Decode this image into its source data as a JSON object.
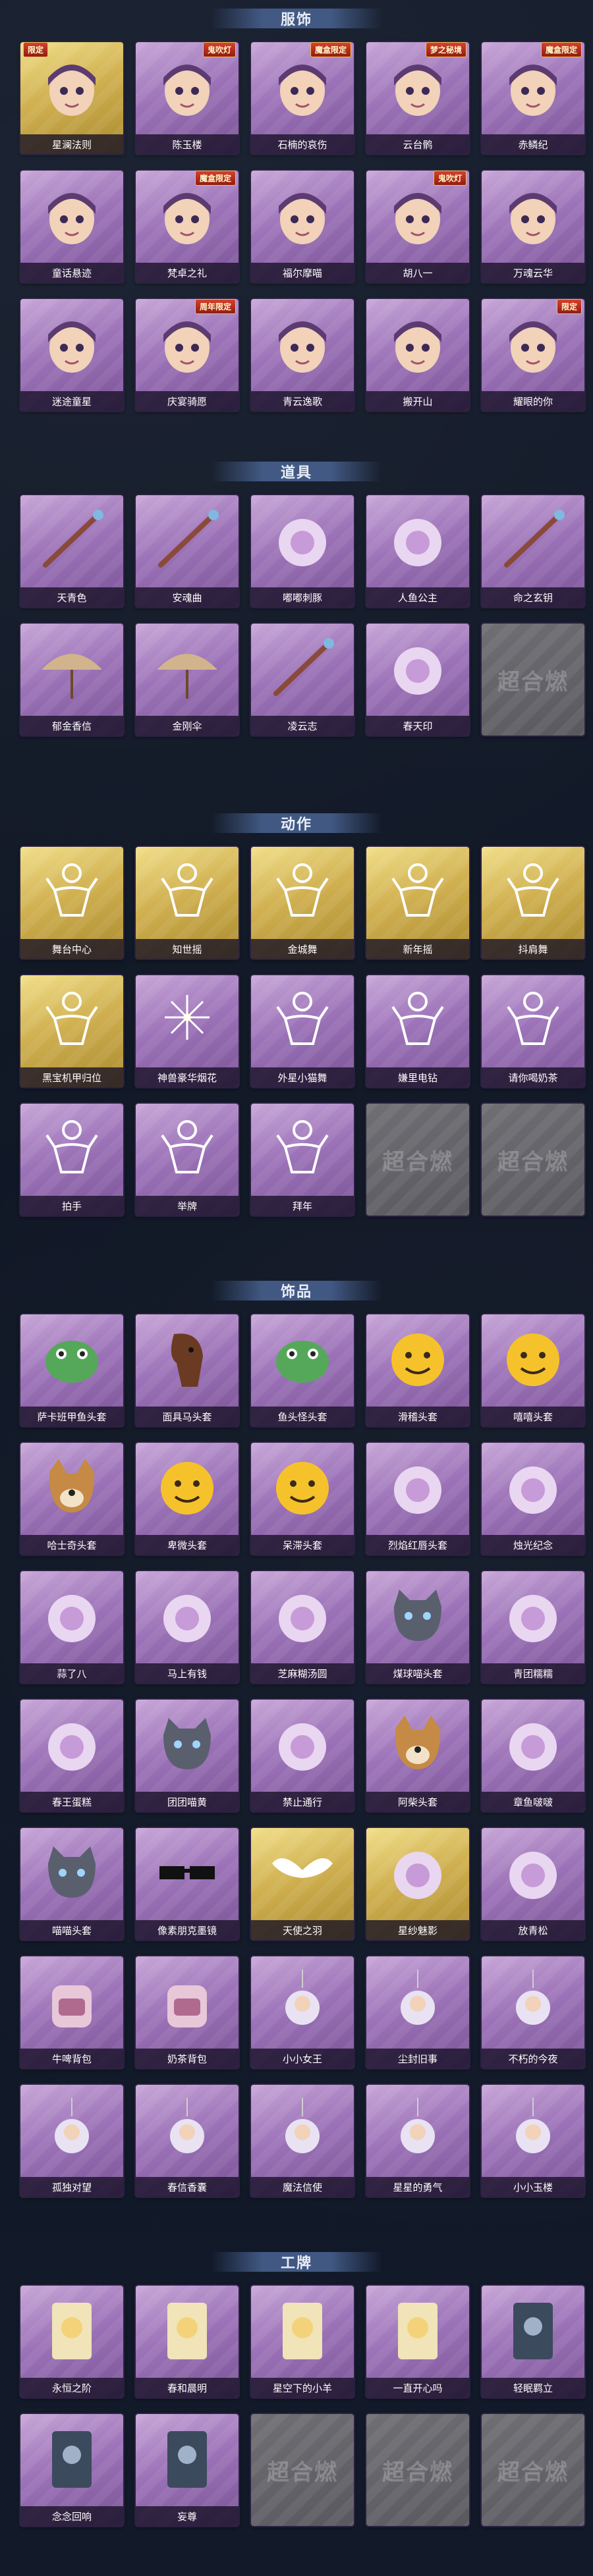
{
  "sections": [
    {
      "title": "服饰",
      "items": [
        {
          "label": "星澜法则",
          "badge": "限定",
          "icon": "character-portrait-icon",
          "tier": "gold"
        },
        {
          "label": "陈玉楼",
          "badge": "鬼吹灯",
          "icon": "character-portrait-icon",
          "tier": "purple"
        },
        {
          "label": "石楠的哀伤",
          "badge": "魔盒限定",
          "icon": "character-portrait-icon",
          "tier": "purple"
        },
        {
          "label": "云台鹘",
          "badge": "梦之秘境",
          "icon": "character-portrait-icon",
          "tier": "purple"
        },
        {
          "label": "赤鳞纪",
          "badge": "魔盒限定",
          "icon": "character-portrait-icon",
          "tier": "purple"
        },
        {
          "label": "童话悬迹",
          "badge": "",
          "icon": "character-portrait-icon",
          "tier": "purple"
        },
        {
          "label": "梵卓之礼",
          "badge": "魔盒限定",
          "icon": "character-portrait-icon",
          "tier": "purple"
        },
        {
          "label": "福尔摩喵",
          "badge": "",
          "icon": "character-portrait-icon",
          "tier": "purple"
        },
        {
          "label": "胡八一",
          "badge": "鬼吹灯",
          "icon": "character-portrait-icon",
          "tier": "purple"
        },
        {
          "label": "万魂云华",
          "badge": "",
          "icon": "character-portrait-icon",
          "tier": "purple"
        },
        {
          "label": "迷途童星",
          "badge": "",
          "icon": "character-portrait-icon",
          "tier": "purple"
        },
        {
          "label": "庆宴骑愿",
          "badge": "周年限定",
          "icon": "character-portrait-icon",
          "tier": "purple"
        },
        {
          "label": "青云逸歌",
          "badge": "",
          "icon": "character-portrait-icon",
          "tier": "purple"
        },
        {
          "label": "搬开山",
          "badge": "",
          "icon": "character-portrait-icon",
          "tier": "purple"
        },
        {
          "label": "耀眼的你",
          "badge": "限定",
          "icon": "character-portrait-icon",
          "tier": "purple"
        }
      ]
    },
    {
      "title": "道具",
      "items": [
        {
          "label": "天青色",
          "badge": "",
          "icon": "wand-icon",
          "tier": "purple"
        },
        {
          "label": "安魂曲",
          "badge": "",
          "icon": "sword-icon",
          "tier": "purple"
        },
        {
          "label": "嘟嘟刺豚",
          "badge": "",
          "icon": "pufferfish-icon",
          "tier": "purple"
        },
        {
          "label": "人鱼公主",
          "badge": "",
          "icon": "mermaid-icon",
          "tier": "purple"
        },
        {
          "label": "命之玄钥",
          "badge": "",
          "icon": "key-icon",
          "tier": "purple"
        },
        {
          "label": "郁金香信",
          "badge": "",
          "icon": "umbrella-icon",
          "tier": "purple"
        },
        {
          "label": "金刚伞",
          "badge": "",
          "icon": "umbrella-icon",
          "tier": "purple"
        },
        {
          "label": "凌云志",
          "badge": "",
          "icon": "spear-icon",
          "tier": "purple"
        },
        {
          "label": "春天印",
          "badge": "",
          "icon": "gift-box-icon",
          "tier": "purple"
        },
        {
          "label": "",
          "badge": "",
          "icon": "",
          "tier": "empty",
          "placeholder": "超合燃"
        }
      ]
    },
    {
      "title": "动作",
      "items": [
        {
          "label": "舞台中心",
          "badge": "",
          "icon": "dance-pose-icon",
          "tier": "gold"
        },
        {
          "label": "知世摇",
          "badge": "",
          "icon": "dance-pose-icon",
          "tier": "gold"
        },
        {
          "label": "金城舞",
          "badge": "",
          "icon": "dance-pose-icon",
          "tier": "gold"
        },
        {
          "label": "新年摇",
          "badge": "",
          "icon": "dance-pose-icon",
          "tier": "gold"
        },
        {
          "label": "抖肩舞",
          "badge": "",
          "icon": "dance-pose-icon",
          "tier": "gold"
        },
        {
          "label": "黑宝机甲归位",
          "badge": "",
          "icon": "dance-pose-icon",
          "tier": "gold"
        },
        {
          "label": "神兽豪华烟花",
          "badge": "",
          "icon": "fireworks-icon",
          "tier": "purple"
        },
        {
          "label": "外星小猫舞",
          "badge": "",
          "icon": "dance-pose-icon",
          "tier": "purple"
        },
        {
          "label": "嫌里电钻",
          "badge": "",
          "icon": "dance-pose-icon",
          "tier": "purple"
        },
        {
          "label": "请你喝奶茶",
          "badge": "",
          "icon": "dance-pose-icon",
          "tier": "purple"
        },
        {
          "label": "拍手",
          "badge": "",
          "icon": "dance-pose-icon",
          "tier": "purple"
        },
        {
          "label": "举牌",
          "badge": "",
          "icon": "dance-pose-icon",
          "tier": "purple"
        },
        {
          "label": "拜年",
          "badge": "",
          "icon": "dance-pose-icon",
          "tier": "purple"
        },
        {
          "label": "",
          "badge": "",
          "icon": "",
          "tier": "empty",
          "placeholder": "超合燃"
        },
        {
          "label": "",
          "badge": "",
          "icon": "",
          "tier": "empty",
          "placeholder": "超合燃"
        }
      ]
    },
    {
      "title": "饰品",
      "items": [
        {
          "label": "萨卡班甲鱼头套",
          "badge": "",
          "icon": "fish-head-icon",
          "tier": "purple"
        },
        {
          "label": "面具马头套",
          "badge": "",
          "icon": "horse-head-icon",
          "tier": "purple"
        },
        {
          "label": "鱼头怪头套",
          "badge": "",
          "icon": "fish-head-icon",
          "tier": "purple"
        },
        {
          "label": "滑稽头套",
          "badge": "",
          "icon": "emoji-face-icon",
          "tier": "purple"
        },
        {
          "label": "嘻嘻头套",
          "badge": "",
          "icon": "emoji-face-icon",
          "tier": "purple"
        },
        {
          "label": "哈士奇头套",
          "badge": "",
          "icon": "dog-head-icon",
          "tier": "purple"
        },
        {
          "label": "卑微头套",
          "badge": "",
          "icon": "emoji-face-icon",
          "tier": "purple"
        },
        {
          "label": "呆滞头套",
          "badge": "",
          "icon": "emoji-face-icon",
          "tier": "purple"
        },
        {
          "label": "烈焰红唇头套",
          "badge": "",
          "icon": "pikachu-head-icon",
          "tier": "purple"
        },
        {
          "label": "烛光纪念",
          "badge": "",
          "icon": "candle-icon",
          "tier": "purple"
        },
        {
          "label": "蒜了八",
          "badge": "",
          "icon": "garlic-icon",
          "tier": "purple"
        },
        {
          "label": "马上有钱",
          "badge": "",
          "icon": "horse-toy-icon",
          "tier": "purple"
        },
        {
          "label": "芝麻糊汤圆",
          "badge": "",
          "icon": "dumpling-icon",
          "tier": "purple"
        },
        {
          "label": "煤球喵头套",
          "badge": "",
          "icon": "cat-head-icon",
          "tier": "purple"
        },
        {
          "label": "青团糯糯",
          "badge": "",
          "icon": "dumpling-icon",
          "tier": "purple"
        },
        {
          "label": "春王蛋糕",
          "badge": "",
          "icon": "cake-icon",
          "tier": "purple"
        },
        {
          "label": "团团喵黄",
          "badge": "",
          "icon": "cat-head-icon",
          "tier": "purple"
        },
        {
          "label": "禁止通行",
          "badge": "",
          "icon": "traffic-cone-icon",
          "tier": "purple"
        },
        {
          "label": "阿柴头套",
          "badge": "",
          "icon": "dog-head-icon",
          "tier": "purple"
        },
        {
          "label": "章鱼啵啵",
          "badge": "",
          "icon": "octopus-icon",
          "tier": "purple"
        },
        {
          "label": "喵喵头套",
          "badge": "",
          "icon": "cat-head-icon",
          "tier": "purple"
        },
        {
          "label": "像素朋克墨镜",
          "badge": "",
          "icon": "sunglasses-icon",
          "tier": "purple"
        },
        {
          "label": "天使之羽",
          "badge": "",
          "icon": "wings-icon",
          "tier": "gold"
        },
        {
          "label": "星纱魅影",
          "badge": "",
          "icon": "veil-icon",
          "tier": "gold"
        },
        {
          "label": "放青松",
          "badge": "",
          "icon": "plant-pot-icon",
          "tier": "purple"
        },
        {
          "label": "牛啤背包",
          "badge": "",
          "icon": "backpack-icon",
          "tier": "purple"
        },
        {
          "label": "奶茶背包",
          "badge": "",
          "icon": "backpack-icon",
          "tier": "purple"
        },
        {
          "label": "小小女王",
          "badge": "",
          "icon": "pendant-icon",
          "tier": "purple"
        },
        {
          "label": "尘封旧事",
          "badge": "",
          "icon": "pendant-icon",
          "tier": "purple"
        },
        {
          "label": "不朽的今夜",
          "badge": "",
          "icon": "pendant-icon",
          "tier": "purple"
        },
        {
          "label": "孤独对望",
          "badge": "",
          "icon": "pendant-icon",
          "tier": "purple"
        },
        {
          "label": "春信香囊",
          "badge": "",
          "icon": "pendant-icon",
          "tier": "purple"
        },
        {
          "label": "魔法信使",
          "badge": "",
          "icon": "pendant-icon",
          "tier": "purple"
        },
        {
          "label": "星星的勇气",
          "badge": "",
          "icon": "pendant-icon",
          "tier": "purple"
        },
        {
          "label": "小小玉楼",
          "badge": "",
          "icon": "pendant-icon",
          "tier": "purple"
        }
      ]
    },
    {
      "title": "工牌",
      "items": [
        {
          "label": "永恒之阶",
          "badge": "",
          "icon": "badge-frame-icon",
          "tier": "purple"
        },
        {
          "label": "春和晨明",
          "badge": "",
          "icon": "badge-frame-icon",
          "tier": "purple"
        },
        {
          "label": "星空下的小羊",
          "badge": "",
          "icon": "badge-frame-icon",
          "tier": "purple"
        },
        {
          "label": "一直开心吗",
          "badge": "",
          "icon": "badge-frame-icon",
          "tier": "purple"
        },
        {
          "label": "轻眠羁立",
          "badge": "",
          "icon": "badge-frame-icon",
          "tier": "gray"
        },
        {
          "label": "念念回响",
          "badge": "",
          "icon": "badge-frame-icon",
          "tier": "gray"
        },
        {
          "label": "妄尊",
          "badge": "",
          "icon": "badge-frame-icon",
          "tier": "gray"
        },
        {
          "label": "",
          "badge": "",
          "icon": "",
          "tier": "empty",
          "placeholder": "超合燃"
        },
        {
          "label": "",
          "badge": "",
          "icon": "",
          "tier": "empty",
          "placeholder": "超合燃"
        },
        {
          "label": "",
          "badge": "",
          "icon": "",
          "tier": "empty",
          "placeholder": "超合燃"
        }
      ]
    }
  ]
}
